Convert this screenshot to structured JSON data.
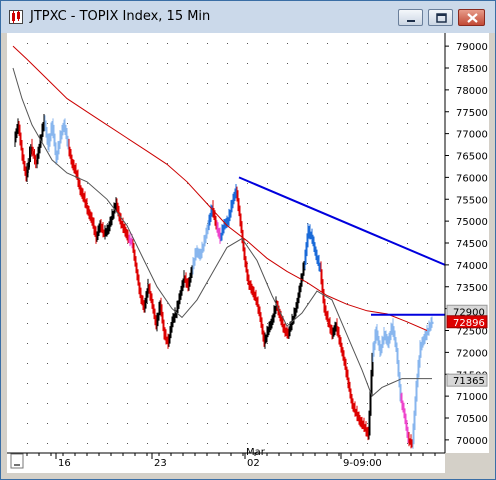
{
  "window": {
    "title": "JTPXC - TOPIX Index, 15 Min",
    "buttons": [
      "minimize",
      "maximize",
      "close"
    ]
  },
  "chart_data": {
    "type": "candlestick-line",
    "title": "JTPXC - TOPIX Index, 15 Min",
    "y_ticks": [
      "79000",
      "78500",
      "78000",
      "77500",
      "77000",
      "76500",
      "76000",
      "75500",
      "75000",
      "74500",
      "74000",
      "73500",
      "73000",
      "72500",
      "72000",
      "71500",
      "71000",
      "70500",
      "70000"
    ],
    "ylim": [
      69700,
      79300
    ],
    "price_labels": [
      {
        "text": "72900",
        "y": 72940,
        "style": "gray"
      },
      {
        "text": "72896",
        "y": 72700,
        "style": "red"
      },
      {
        "text": "71365",
        "y": 71365,
        "style": "gray"
      }
    ],
    "x_labels": [
      "16",
      "23",
      "Mar",
      "02",
      "9-09:00"
    ],
    "grid": true,
    "trendlines": [
      {
        "name": "descending resistance",
        "color": "#0000dd",
        "points": [
          [
            232,
            76000
          ],
          [
            438,
            74000
          ]
        ]
      },
      {
        "name": "horizontal resistance",
        "color": "#0000dd",
        "points": [
          [
            364,
            72860
          ],
          [
            438,
            72860
          ]
        ]
      }
    ],
    "series": [
      {
        "name": "moving average (long)",
        "color": "#cc0000",
        "points": [
          [
            6,
            79000
          ],
          [
            20,
            78700
          ],
          [
            40,
            78250
          ],
          [
            60,
            77800
          ],
          [
            80,
            77500
          ],
          [
            100,
            77200
          ],
          [
            120,
            76900
          ],
          [
            140,
            76600
          ],
          [
            160,
            76300
          ],
          [
            180,
            75900
          ],
          [
            200,
            75400
          ],
          [
            220,
            74900
          ],
          [
            240,
            74550
          ],
          [
            260,
            74150
          ],
          [
            280,
            73850
          ],
          [
            300,
            73600
          ],
          [
            320,
            73300
          ],
          [
            340,
            73100
          ],
          [
            360,
            72950
          ],
          [
            380,
            72880
          ],
          [
            400,
            72700
          ],
          [
            420,
            72500
          ]
        ]
      },
      {
        "name": "moving average (short)",
        "color": "#555555",
        "points": [
          [
            6,
            78500
          ],
          [
            15,
            77800
          ],
          [
            25,
            77200
          ],
          [
            35,
            76800
          ],
          [
            45,
            76400
          ],
          [
            60,
            76100
          ],
          [
            80,
            75900
          ],
          [
            100,
            75500
          ],
          [
            120,
            74900
          ],
          [
            135,
            74200
          ],
          [
            150,
            73500
          ],
          [
            165,
            73000
          ],
          [
            175,
            72800
          ],
          [
            190,
            73200
          ],
          [
            205,
            73800
          ],
          [
            220,
            74400
          ],
          [
            235,
            74600
          ],
          [
            250,
            74100
          ],
          [
            265,
            73300
          ],
          [
            280,
            72600
          ],
          [
            295,
            72900
          ],
          [
            310,
            73400
          ],
          [
            325,
            73200
          ],
          [
            340,
            72400
          ],
          [
            355,
            71600
          ],
          [
            365,
            71000
          ],
          [
            375,
            71200
          ],
          [
            385,
            71300
          ],
          [
            395,
            71400
          ],
          [
            410,
            71400
          ],
          [
            425,
            71400
          ]
        ]
      }
    ],
    "price_path": [
      [
        8,
        76800
      ],
      [
        12,
        77200
      ],
      [
        16,
        76500
      ],
      [
        20,
        76000
      ],
      [
        25,
        76700
      ],
      [
        30,
        76300
      ],
      [
        34,
        76800
      ],
      [
        38,
        77300
      ],
      [
        42,
        76700
      ],
      [
        46,
        77200
      ],
      [
        50,
        76400
      ],
      [
        54,
        76900
      ],
      [
        58,
        77200
      ],
      [
        62,
        76700
      ],
      [
        66,
        76300
      ],
      [
        70,
        76100
      ],
      [
        74,
        75700
      ],
      [
        78,
        75500
      ],
      [
        82,
        75200
      ],
      [
        86,
        75000
      ],
      [
        90,
        74600
      ],
      [
        94,
        74900
      ],
      [
        98,
        74700
      ],
      [
        102,
        74800
      ],
      [
        106,
        75100
      ],
      [
        110,
        75400
      ],
      [
        114,
        75000
      ],
      [
        118,
        74800
      ],
      [
        122,
        74600
      ],
      [
        126,
        74500
      ],
      [
        130,
        73900
      ],
      [
        134,
        73300
      ],
      [
        138,
        73000
      ],
      [
        142,
        73500
      ],
      [
        146,
        73100
      ],
      [
        150,
        72600
      ],
      [
        154,
        73100
      ],
      [
        158,
        72400
      ],
      [
        162,
        72200
      ],
      [
        166,
        72700
      ],
      [
        170,
        72900
      ],
      [
        174,
        73300
      ],
      [
        178,
        73700
      ],
      [
        182,
        73500
      ],
      [
        186,
        73900
      ],
      [
        190,
        74300
      ],
      [
        194,
        74200
      ],
      [
        198,
        74500
      ],
      [
        202,
        74900
      ],
      [
        206,
        75300
      ],
      [
        210,
        74900
      ],
      [
        214,
        74600
      ],
      [
        218,
        74900
      ],
      [
        222,
        75000
      ],
      [
        226,
        75400
      ],
      [
        230,
        75700
      ],
      [
        234,
        75000
      ],
      [
        238,
        74200
      ],
      [
        242,
        73600
      ],
      [
        246,
        73400
      ],
      [
        250,
        73200
      ],
      [
        254,
        72800
      ],
      [
        258,
        72200
      ],
      [
        262,
        72500
      ],
      [
        266,
        72700
      ],
      [
        270,
        73100
      ],
      [
        274,
        72800
      ],
      [
        278,
        72500
      ],
      [
        282,
        72400
      ],
      [
        286,
        72700
      ],
      [
        290,
        73000
      ],
      [
        294,
        73500
      ],
      [
        298,
        74000
      ],
      [
        302,
        74800
      ],
      [
        306,
        74600
      ],
      [
        310,
        74200
      ],
      [
        314,
        73900
      ],
      [
        318,
        73000
      ],
      [
        322,
        72700
      ],
      [
        326,
        72400
      ],
      [
        330,
        72600
      ],
      [
        334,
        72200
      ],
      [
        338,
        71800
      ],
      [
        342,
        71300
      ],
      [
        346,
        70800
      ],
      [
        350,
        70600
      ],
      [
        354,
        70400
      ],
      [
        358,
        70300
      ],
      [
        362,
        70100
      ],
      [
        366,
        71900
      ],
      [
        370,
        72500
      ],
      [
        374,
        72000
      ],
      [
        378,
        72400
      ],
      [
        382,
        72200
      ],
      [
        386,
        72600
      ],
      [
        390,
        72100
      ],
      [
        394,
        71000
      ],
      [
        398,
        70600
      ],
      [
        402,
        70000
      ],
      [
        406,
        69900
      ],
      [
        410,
        71200
      ],
      [
        414,
        72100
      ],
      [
        418,
        72300
      ],
      [
        422,
        72500
      ],
      [
        426,
        72700
      ]
    ],
    "colors": {
      "bearish": "#dd0000",
      "bullish": "#000000",
      "up_light": "#88b6ee",
      "up_dark": "#1a6ad8",
      "magenta": "#ee44cc",
      "grid": "#555555"
    }
  }
}
